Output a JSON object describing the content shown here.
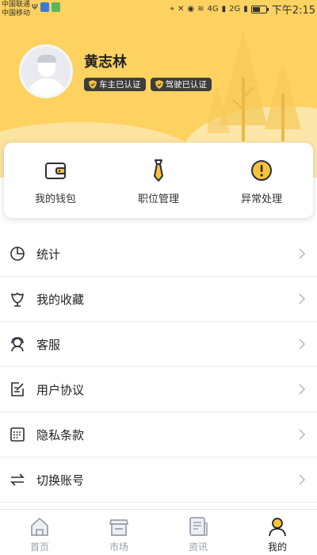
{
  "status_bar": {
    "carrier_1": "中国联通",
    "carrier_2": "中国移动",
    "net_1": "4G",
    "net_2": "2G",
    "battery_level": 0.55,
    "time": "下午2:15"
  },
  "profile": {
    "name": "黄志林",
    "badges": [
      "车主已认证",
      "驾驶已认证"
    ]
  },
  "quick_actions": [
    {
      "label": "我的钱包",
      "icon": "wallet-icon"
    },
    {
      "label": "职位管理",
      "icon": "tie-icon"
    },
    {
      "label": "异常处理",
      "icon": "alert-icon"
    }
  ],
  "menu": [
    {
      "label": "统计",
      "icon": "pie-chart-icon"
    },
    {
      "label": "我的收藏",
      "icon": "flower-icon"
    },
    {
      "label": "客服",
      "icon": "headset-icon"
    },
    {
      "label": "用户协议",
      "icon": "edit-note-icon"
    },
    {
      "label": "隐私条款",
      "icon": "document-icon"
    },
    {
      "label": "切换账号",
      "icon": "swap-icon"
    }
  ],
  "bottom_nav": [
    {
      "label": "首页",
      "icon": "home-icon",
      "active": false
    },
    {
      "label": "市场",
      "icon": "store-icon",
      "active": false
    },
    {
      "label": "资讯",
      "icon": "news-icon",
      "active": false
    },
    {
      "label": "我的",
      "icon": "user-icon",
      "active": true
    }
  ],
  "colors": {
    "header_yellow": "#fdd260",
    "header_hill": "#fce6a9",
    "tree": "#f6c95a",
    "badge_bg": "#3c3c3c",
    "accent_yellow": "#f5c23a",
    "icon_dark": "#2b2d3a",
    "nav_inactive": "#9a9fab"
  }
}
